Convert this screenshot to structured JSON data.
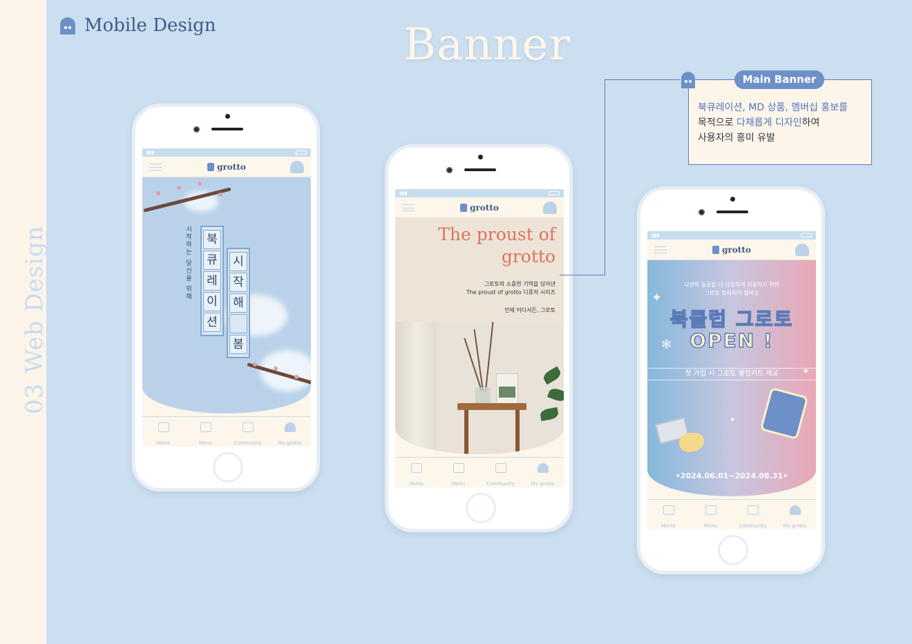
{
  "section": {
    "number": "03",
    "vertical_label": "Web Design",
    "title": "Mobile Design"
  },
  "page_title": "Banner",
  "colors": {
    "background": "#cbdff0",
    "cream": "#fdf6ea",
    "accent_blue": "#6d90c9",
    "dark_blue": "#3f5a8a",
    "coral": "#d9745f"
  },
  "app": {
    "brand": "grotto",
    "tabs": [
      {
        "label": "Home",
        "icon": "house-icon"
      },
      {
        "label": "Menu",
        "icon": "list-icon"
      },
      {
        "label": "Community",
        "icon": "chat-icon"
      },
      {
        "label": "My grotto",
        "icon": "ghost-icon"
      }
    ]
  },
  "phones": [
    {
      "banner": {
        "subtitle": "시작하는 당신을 위해",
        "col1": [
          "북",
          "큐",
          "레",
          "이",
          "션"
        ],
        "col2": [
          "시",
          "작",
          "해",
          "",
          "봄"
        ]
      }
    },
    {
      "banner": {
        "headline_1": "The proust of",
        "headline_2": "grotto",
        "line_1": "그로토의 소중한 기억을 담아낸",
        "line_2": "The proust of grotto 디퓨저 시리즈",
        "line_3": "언제 어디서든, 그로토"
      }
    },
    {
      "banner": {
        "intro_1": "나만의 동굴을 더 다양하게 이용하기 위한",
        "intro_2": "그로토 프리미어 멤버십",
        "title_1": "북클럽 그로토",
        "title_2": "OPEN !",
        "offer": "첫 가입 시 그로토 웰컴키트 제공",
        "dates": "•2024.06.01~2024.08.31•"
      }
    }
  ],
  "annotation": {
    "label": "Main Banner",
    "line1_a": "북큐레이션, MD 상품, 멤버십 홍보를",
    "line2_a": "목적으로 ",
    "line2_hl": "다채롭게 디자인",
    "line2_b": "하여",
    "line3": "사용자의 흥미 유발"
  }
}
